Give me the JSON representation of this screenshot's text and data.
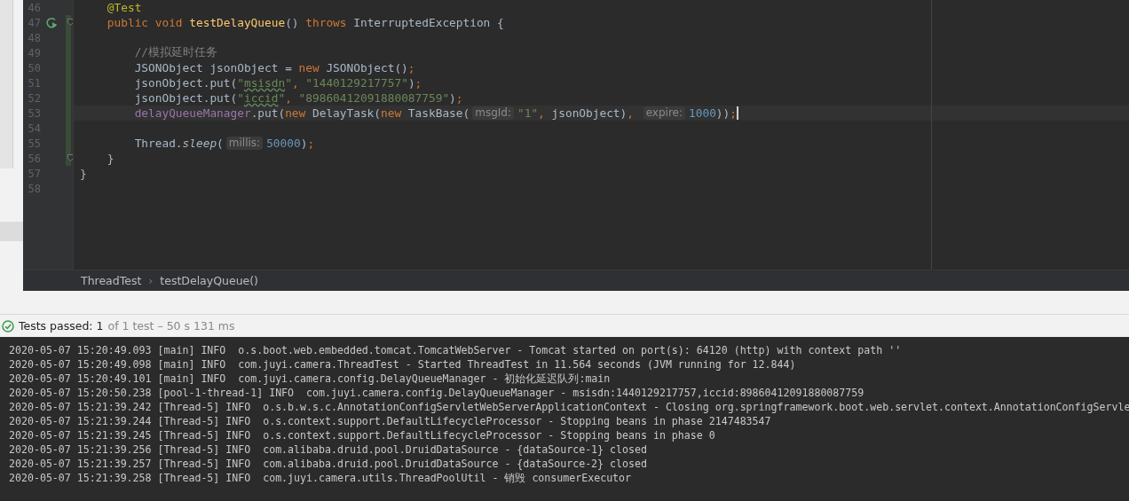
{
  "editor": {
    "lines": [
      {
        "number": "46",
        "changed": false,
        "current": false,
        "run": false,
        "fold": false,
        "tokens": [
          {
            "kind": "annot",
            "text": "    @Test"
          }
        ]
      },
      {
        "number": "47",
        "changed": true,
        "current": false,
        "run": true,
        "fold": true,
        "tokens": [
          {
            "kind": "kw",
            "text": "    public void "
          },
          {
            "kind": "decl",
            "text": "testDelayQueue"
          },
          {
            "kind": "plain",
            "text": "() "
          },
          {
            "kind": "kw",
            "text": "throws "
          },
          {
            "kind": "plain",
            "text": "InterruptedException {"
          }
        ]
      },
      {
        "number": "48",
        "changed": true,
        "current": false,
        "run": false,
        "fold": false
      },
      {
        "number": "49",
        "changed": true,
        "current": false,
        "run": false,
        "fold": false,
        "tokens": [
          {
            "kind": "comment",
            "text": "        //模拟延时任务"
          }
        ]
      },
      {
        "number": "50",
        "changed": true,
        "current": false,
        "run": false,
        "fold": false,
        "tokens": [
          {
            "kind": "plain",
            "text": "        JSONObject jsonObject = "
          },
          {
            "kind": "kw",
            "text": "new "
          },
          {
            "kind": "plain",
            "text": "JSONObject()"
          },
          {
            "kind": "kw",
            "text": ";"
          }
        ]
      },
      {
        "number": "51",
        "changed": true,
        "current": false,
        "run": false,
        "fold": false,
        "tokens": [
          {
            "kind": "plain",
            "text": "        jsonObject.put("
          },
          {
            "kind": "str",
            "text": "\""
          },
          {
            "kind": "typo",
            "text": "msisdn"
          },
          {
            "kind": "str",
            "text": "\""
          },
          {
            "kind": "kw",
            "text": ", "
          },
          {
            "kind": "str",
            "text": "\"1440129217757\""
          },
          {
            "kind": "plain",
            "text": ")"
          },
          {
            "kind": "kw",
            "text": ";"
          }
        ]
      },
      {
        "number": "52",
        "changed": true,
        "current": false,
        "run": false,
        "fold": false,
        "tokens": [
          {
            "kind": "plain",
            "text": "        jsonObject.put("
          },
          {
            "kind": "str",
            "text": "\""
          },
          {
            "kind": "typo",
            "text": "iccid"
          },
          {
            "kind": "str",
            "text": "\""
          },
          {
            "kind": "kw",
            "text": ", "
          },
          {
            "kind": "str",
            "text": "\"89860412091880087759\""
          },
          {
            "kind": "plain",
            "text": ")"
          },
          {
            "kind": "kw",
            "text": ";"
          }
        ]
      },
      {
        "number": "53",
        "changed": true,
        "current": true,
        "run": false,
        "fold": false,
        "tokens": [
          {
            "kind": "field",
            "text": "        delayQueueManager"
          },
          {
            "kind": "plain",
            "text": ".put("
          },
          {
            "kind": "kw",
            "text": "new "
          },
          {
            "kind": "plain",
            "text": "DelayTask("
          },
          {
            "kind": "kw",
            "text": "new "
          },
          {
            "kind": "plain",
            "text": "TaskBase("
          },
          {
            "kind": "hint",
            "text": "msgId:"
          },
          {
            "kind": "str",
            "text": "\"1\""
          },
          {
            "kind": "kw",
            "text": ", "
          },
          {
            "kind": "plain",
            "text": "jsonObject)"
          },
          {
            "kind": "kw",
            "text": ", "
          },
          {
            "kind": "hint",
            "text": "expire:"
          },
          {
            "kind": "num",
            "text": "1000"
          },
          {
            "kind": "plain",
            "text": "))"
          },
          {
            "kind": "kw",
            "text": ";"
          }
        ]
      },
      {
        "number": "54",
        "changed": true,
        "current": false,
        "run": false,
        "fold": false
      },
      {
        "number": "55",
        "changed": true,
        "current": false,
        "run": false,
        "fold": false,
        "tokens": [
          {
            "kind": "plain",
            "text": "        Thread."
          },
          {
            "kind": "italic",
            "text": "sleep"
          },
          {
            "kind": "plain",
            "text": "("
          },
          {
            "kind": "hint",
            "text": "millis:"
          },
          {
            "kind": "num",
            "text": "50000"
          },
          {
            "kind": "plain",
            "text": ")"
          },
          {
            "kind": "kw",
            "text": ";"
          }
        ]
      },
      {
        "number": "56",
        "changed": true,
        "current": false,
        "run": false,
        "fold": true,
        "tokens": [
          {
            "kind": "plain",
            "text": "    }"
          }
        ]
      },
      {
        "number": "57",
        "changed": false,
        "current": false,
        "run": false,
        "fold": false,
        "tokens": [
          {
            "kind": "plain",
            "text": "}"
          }
        ]
      },
      {
        "number": "58",
        "changed": false,
        "current": false,
        "run": false,
        "fold": false
      }
    ]
  },
  "breadcrumb": [
    "ThreadTest",
    "›",
    "testDelayQueue()"
  ],
  "status": {
    "summary": "Tests passed: 1",
    "detail": "of 1 test – 50 s 131 ms"
  },
  "console": [
    "2020-05-07 15:20:49.093 [main] INFO  o.s.boot.web.embedded.tomcat.TomcatWebServer - Tomcat started on port(s): 64120 (http) with context path ''",
    "2020-05-07 15:20:49.098 [main] INFO  com.juyi.camera.ThreadTest - Started ThreadTest in 11.564 seconds (JVM running for 12.844)",
    "2020-05-07 15:20:49.101 [main] INFO  com.juyi.camera.config.DelayQueueManager - 初始化延迟队列:main",
    "2020-05-07 15:20:50.238 [pool-1-thread-1] INFO  com.juyi.camera.config.DelayQueueManager - msisdn:1440129217757,iccid:89860412091880087759",
    "2020-05-07 15:21:39.242 [Thread-5] INFO  o.s.b.w.s.c.AnnotationConfigServletWebServerApplicationContext - Closing org.springframework.boot.web.servlet.context.AnnotationConfigServle",
    "2020-05-07 15:21:39.244 [Thread-5] INFO  o.s.context.support.DefaultLifecycleProcessor - Stopping beans in phase 2147483547",
    "2020-05-07 15:21:39.245 [Thread-5] INFO  o.s.context.support.DefaultLifecycleProcessor - Stopping beans in phase 0",
    "2020-05-07 15:21:39.256 [Thread-5] INFO  com.alibaba.druid.pool.DruidDataSource - {dataSource-1} closed",
    "2020-05-07 15:21:39.257 [Thread-5] INFO  com.alibaba.druid.pool.DruidDataSource - {dataSource-2} closed",
    "2020-05-07 15:21:39.258 [Thread-5] INFO  com.juyi.camera.utils.ThreadPoolUtil - 销毁 consumerExecutor"
  ]
}
